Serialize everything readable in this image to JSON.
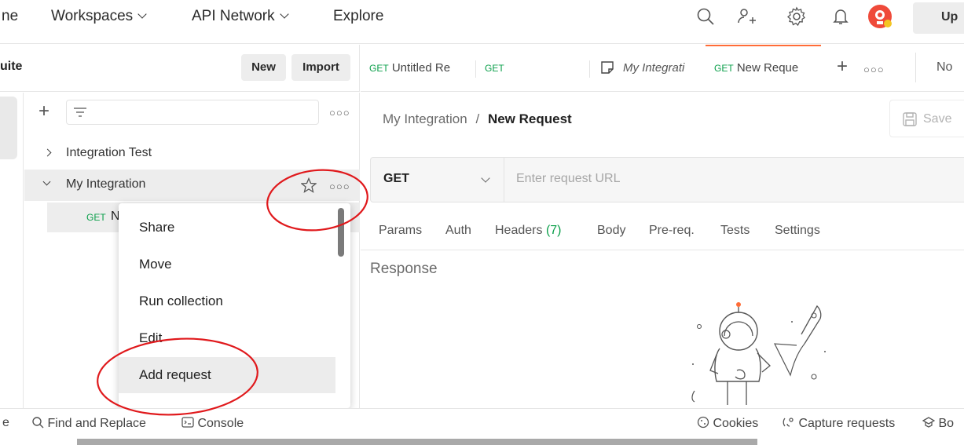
{
  "top_nav": {
    "home_label": "ne",
    "workspaces_label": "Workspaces",
    "api_network_label": "API Network",
    "explore_label": "Explore",
    "upgrade_label": "Up"
  },
  "sidebar": {
    "workspace_name": "uite",
    "new_label": "New",
    "import_label": "Import",
    "collections": [
      {
        "name": "Integration Test",
        "expanded": false
      },
      {
        "name": "My Integration",
        "expanded": true
      }
    ],
    "request_row": {
      "method": "GET",
      "name": "N"
    }
  },
  "context_menu": {
    "items": [
      "Share",
      "Move",
      "Run collection",
      "Edit",
      "Add request"
    ]
  },
  "tabs": [
    {
      "method": "GET",
      "title": "Untitled Re"
    },
    {
      "method": "GET",
      "title": ""
    },
    {
      "method": "",
      "title": "My Integrati"
    },
    {
      "method": "GET",
      "title": "New Reque"
    }
  ],
  "tabs_extra": {
    "no_env_label": "No"
  },
  "request": {
    "breadcrumb_parent": "My Integration",
    "breadcrumb_sep": "/",
    "breadcrumb_current": "New Request",
    "save_label": "Save",
    "method": "GET",
    "url_placeholder": "Enter request URL",
    "tabs": {
      "params": "Params",
      "auth": "Auth",
      "headers": "Headers",
      "headers_count": "(7)",
      "body": "Body",
      "prereq": "Pre-req.",
      "tests": "Tests",
      "settings": "Settings"
    },
    "response_label": "Response"
  },
  "status_bar": {
    "left_fragment": "e",
    "find_replace": "Find and Replace",
    "console": "Console",
    "cookies": "Cookies",
    "capture": "Capture requests",
    "bootcamp": "Bo"
  },
  "colors": {
    "accent": "#ff6c37",
    "get_green": "#0a9f4a",
    "annotation_red": "#e0191c"
  }
}
